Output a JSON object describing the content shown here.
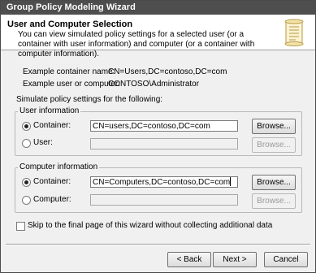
{
  "window": {
    "title": "Group Policy Modeling Wizard"
  },
  "header": {
    "title": "User and Computer Selection",
    "description": "You can view simulated policy settings for a selected user (or a container with user information) and computer (or a container with computer information).",
    "icon": "scroll-icon"
  },
  "examples": {
    "container_label": "Example container name:",
    "container_value": "CN=Users,DC=contoso,DC=com",
    "user_label": "Example user or computer:",
    "user_value": "CONTOSO\\Administrator"
  },
  "simulate_label": "Simulate policy settings for the following:",
  "user_info": {
    "legend": "User information",
    "container_label": "Container:",
    "container_value": "CN=users,DC=contoso,DC=com",
    "user_label": "User:",
    "user_value": "",
    "browse1": "Browse...",
    "browse2": "Browse...",
    "selected": "container"
  },
  "computer_info": {
    "legend": "Computer information",
    "container_label": "Container:",
    "container_value": "CN=Computers,DC=contoso,DC=com",
    "computer_label": "Computer:",
    "computer_value": "",
    "browse1": "Browse...",
    "browse2": "Browse...",
    "selected": "container"
  },
  "skip": {
    "label": "Skip to the final page of this wizard without collecting additional data",
    "checked": false
  },
  "buttons": {
    "back": "< Back",
    "next": "Next >",
    "cancel": "Cancel"
  }
}
